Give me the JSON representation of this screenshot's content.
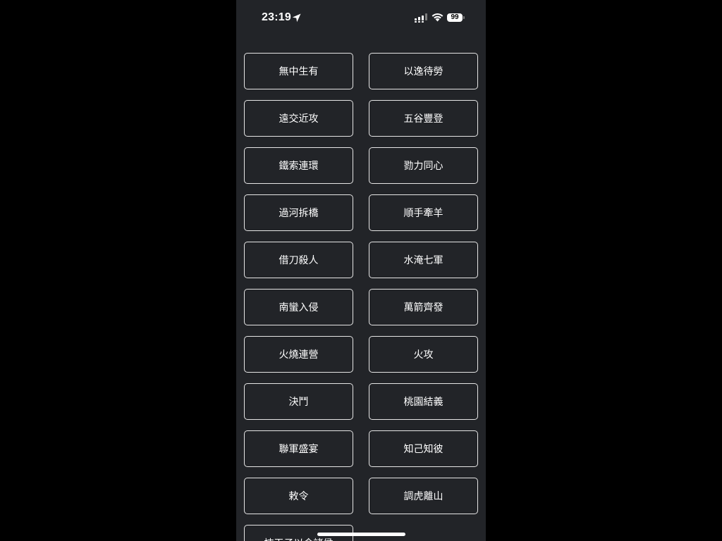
{
  "status_bar": {
    "time": "23:19",
    "battery_level": "99",
    "icons": [
      "location-arrow-icon",
      "cellular-signal-icon",
      "wifi-icon",
      "battery-icon"
    ]
  },
  "buttons": [
    {
      "label": "無中生有"
    },
    {
      "label": "以逸待勞"
    },
    {
      "label": "遠交近攻"
    },
    {
      "label": "五谷豐登"
    },
    {
      "label": "鐵索連環"
    },
    {
      "label": "勠力同心"
    },
    {
      "label": "過河拆橋"
    },
    {
      "label": "順手牽羊"
    },
    {
      "label": "借刀殺人"
    },
    {
      "label": "水淹七軍"
    },
    {
      "label": "南蠻入侵"
    },
    {
      "label": "萬箭齊發"
    },
    {
      "label": "火燒連營"
    },
    {
      "label": "火攻"
    },
    {
      "label": "決鬥"
    },
    {
      "label": "桃園結義"
    },
    {
      "label": "聯軍盛宴"
    },
    {
      "label": "知己知彼"
    },
    {
      "label": "敕令"
    },
    {
      "label": "調虎離山"
    },
    {
      "label": "挾天子以令諸侯"
    }
  ],
  "colors": {
    "screen_background": "#222428",
    "outer_background": "#000000",
    "button_border": "#e6e6e6",
    "text": "#ffffff"
  }
}
